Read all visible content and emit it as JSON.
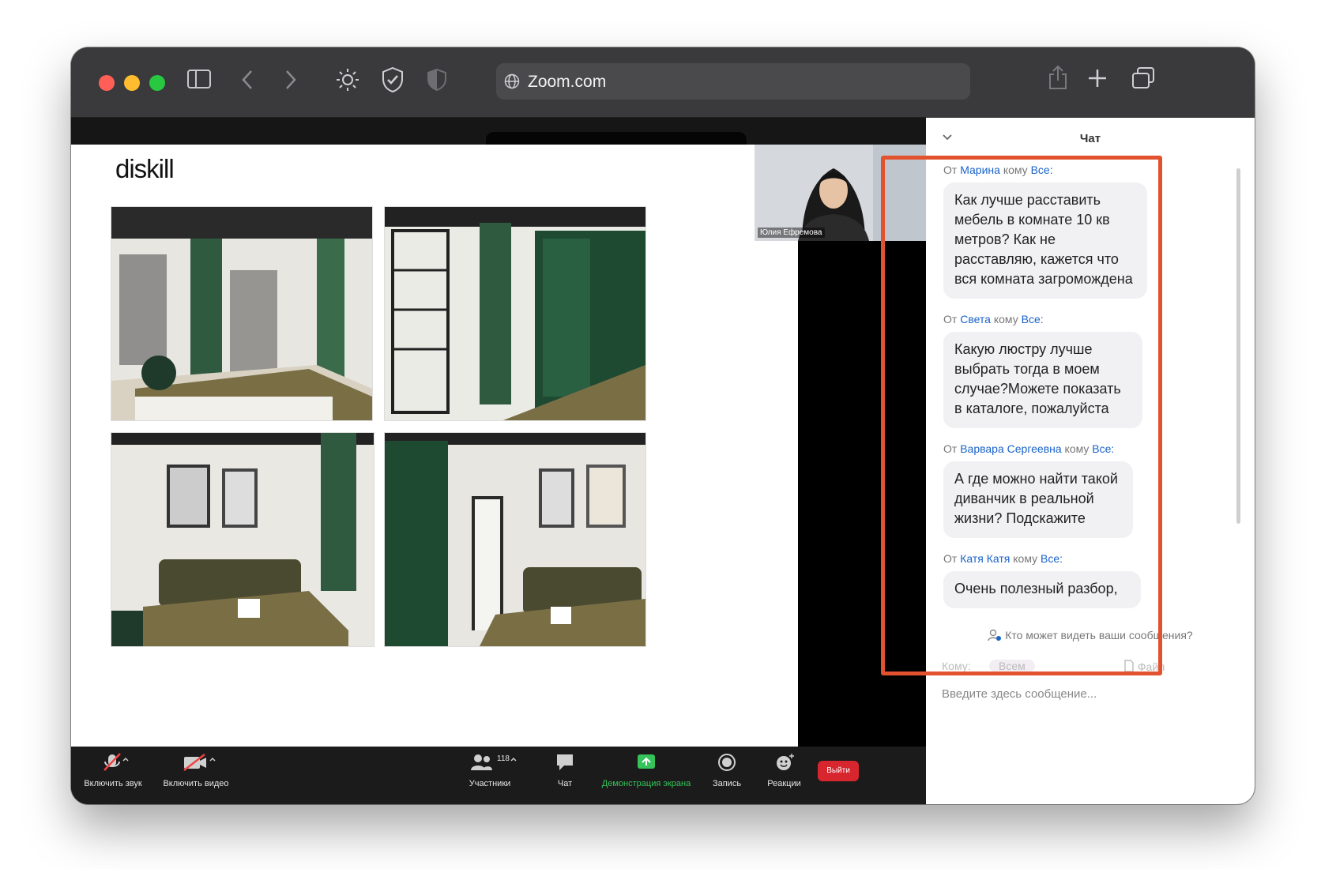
{
  "browser": {
    "url": "Zoom.com"
  },
  "slide": {
    "brand": "diskill"
  },
  "camera": {
    "participant_name": "Юлия Ефремова"
  },
  "toolbar": {
    "mute_label": "Включить звук",
    "video_label": "Включить видео",
    "participants_label": "Участники",
    "participants_count": "118",
    "chat_label": "Чат",
    "share_label": "Демонстрация экрана",
    "record_label": "Запись",
    "reactions_label": "Реакции",
    "exit_label": "Выйти"
  },
  "chat": {
    "title": "Чат",
    "messages": [
      {
        "from_prefix": "От",
        "name": "Марина",
        "to_prefix": "кому",
        "to": "Все:",
        "text": "Как лучше расставить мебель в комнате 10 кв метров? Как не расставляю, кажется что вся комната загромождена"
      },
      {
        "from_prefix": "От",
        "name": "Света",
        "to_prefix": "кому",
        "to": "Все:",
        "text": "Какую люстру лучше выбрать тогда в моем случае?Можете показать в каталоге, пожалуйста"
      },
      {
        "from_prefix": "От",
        "name": "Варвара Сергеевна",
        "to_prefix": "кому",
        "to": "Все:",
        "text": "А где можно найти такой диванчик в реальной жизни? Подскажите"
      },
      {
        "from_prefix": "От",
        "name": "Катя Катя",
        "to_prefix": "кому",
        "to": "Все:",
        "text": "Очень полезный разбор,"
      }
    ],
    "who_can_see": "Кто может видеть ваши сообщения?",
    "to_label": "Кому:",
    "to_value": "Всем",
    "file_label": "Файл",
    "input_placeholder": "Введите здесь сообщение..."
  },
  "colors": {
    "highlight": "#e3522e",
    "link": "#1a63c9",
    "share_green": "#35c45a",
    "exit_red": "#d8262e"
  }
}
